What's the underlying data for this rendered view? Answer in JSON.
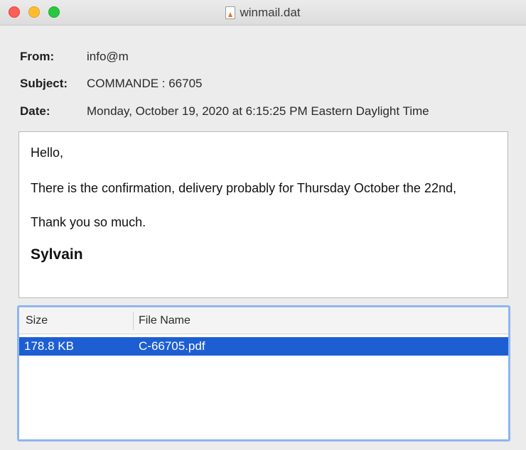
{
  "window": {
    "title": "winmail.dat",
    "title_icon": "document-icon"
  },
  "header": {
    "from_label": "From:",
    "from_value": "info@m",
    "subject_label": "Subject:",
    "subject_value": "COMMANDE : 66705",
    "date_label": "Date:",
    "date_value": "Monday, October 19, 2020 at 6:15:25 PM Eastern Daylight Time"
  },
  "message": {
    "greeting": "Hello,",
    "line1": "There is the confirmation, delivery probably for Thursday October the 22nd,",
    "line2": "Thank you so much.",
    "signature": "Sylvain"
  },
  "attachments": {
    "columns": [
      "Size",
      "File Name"
    ],
    "rows": [
      {
        "size": "178.8 KB",
        "name": "C-66705.pdf"
      }
    ]
  },
  "colors": {
    "selection": "#1d5fd2",
    "focus_ring": "#8fb6ee",
    "close": "#fe5f57",
    "minimize": "#febc2e",
    "maximize": "#28c840"
  }
}
